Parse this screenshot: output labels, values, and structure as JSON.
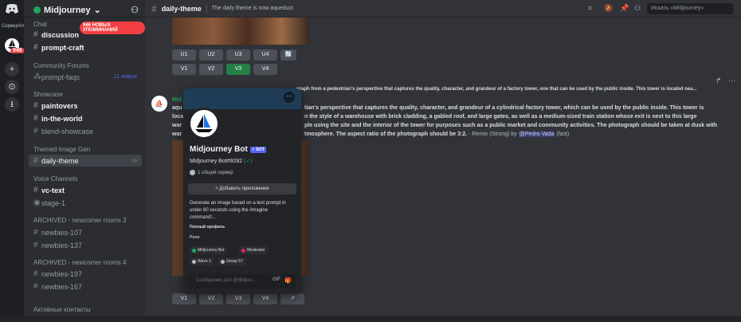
{
  "rail": {
    "label": "СерверАп",
    "badge": "946",
    "items": [
      "+",
      "⊙",
      "⭳"
    ]
  },
  "sidebar": {
    "server_name": "Midjourney",
    "unread_pill": "946 НОВЫХ УПОМИНАНИЙ",
    "categories": {
      "chat": "Chat",
      "community": "Community Forums",
      "showcase": "Showcase",
      "themed": "Themed Image Gen",
      "voice": "Voice Channels",
      "archived3": "ARCHIVED - newcomer rooms 3",
      "archived4": "ARCHIVED - newcomer rooms 4",
      "active": "Активные контакты"
    },
    "channels": {
      "discussion": "discussion",
      "prompt_craft": "prompt-craft",
      "prompt_faqs": "prompt-faqs",
      "prompt_faqs_badge": "11 новых",
      "paintovers": "paintovers",
      "in_the_world": "in-the-world",
      "blend_showcase": "blend-showcase",
      "daily_theme": "daily-theme",
      "vc_text": "vc-text",
      "stage_1": "stage-1",
      "newbies_107": "newbies-107",
      "newbies_137": "newbies-137",
      "newbies_197": "newbies-197",
      "newbies_167": "newbies-167"
    }
  },
  "topbar": {
    "channel": "daily-theme",
    "topic": "The daily theme is now aqueduct",
    "search_placeholder": "Искать «Midjourney»"
  },
  "message": {
    "buttons_u": [
      "U1",
      "U2",
      "U3",
      "U4"
    ],
    "buttons_v": [
      "V1",
      "V2",
      "V3",
      "V4"
    ],
    "refresh": "🔄",
    "reply_line": "graph from a pedestrian's perspective that captures the quality, character, and grandeur of a factory tower, one that can be used by the public inside. This tower is located nea...",
    "author_frag": "Mid",
    "line1": "aqu",
    "text1": "tian's perspective that captures the quality, character, and grandeur of a cylindrical factory tower, which can be used by the public inside. This tower is",
    "line2": "loca",
    "text2": "n the style of a warehouse with brick cladding, a gabled roof, and large gates, as well as a medium-sized train station whose exit is next to this large",
    "line3": "war",
    "text3": "ple using the site and the interior of the tower for purposes such as a public market and community activities. The photograph should be taken at dusk with",
    "line4": "war",
    "text4": "tmosphere. The aspect ratio of the photograph should be 3:2.",
    "suffix": "- Remix (Strong) by",
    "mention": "@Pedro Vada",
    "speed": "(fast)"
  },
  "popout": {
    "name": "Midjourney Bot",
    "bot_tag": "✓ БОТ",
    "tag": "Midjourney Bot#9282",
    "mutual": "1 общий сервер",
    "add_app": "+ Добавить приложение",
    "description": "Generate an image based on a text prompt in under 60 seconds using the /imagine command!...",
    "full_profile": "Полный профиль",
    "roles_header": "Роли",
    "roles": [
      {
        "name": "Midjourney Bot",
        "color": "#23a55a"
      },
      {
        "name": "Moderator",
        "color": "#e91e63"
      },
      {
        "name": "Wave 1",
        "color": "#b5bac1"
      },
      {
        "name": "Group 57",
        "color": "#b5bac1"
      }
    ],
    "message_placeholder": "Сообщение для @Midjou...",
    "gif": "GIF",
    "gift": "🎁"
  },
  "colors": {
    "accent": "#5865f2",
    "green": "#248046",
    "danger": "#f23f43"
  }
}
